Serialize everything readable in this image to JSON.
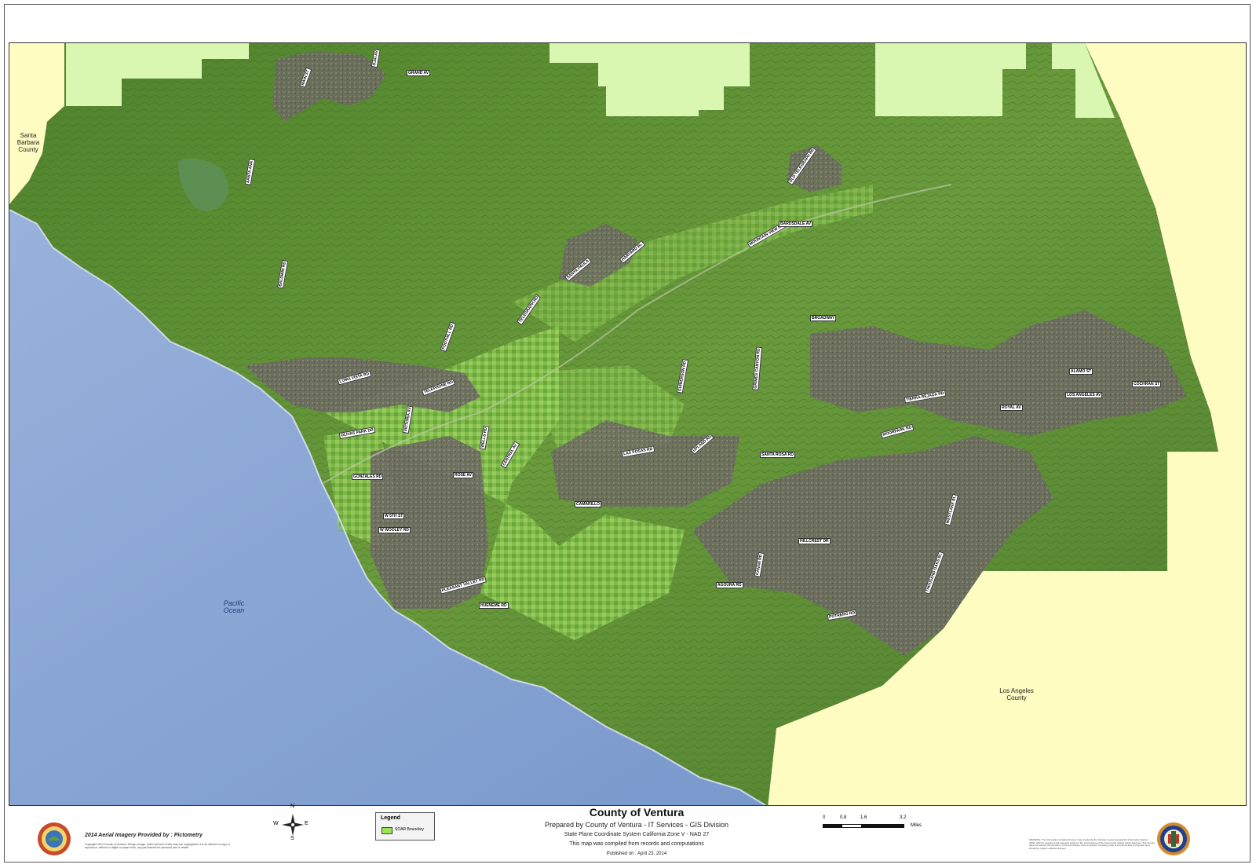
{
  "map": {
    "labels": {
      "santa_barbara": "Santa\nBarbara\nCounty",
      "los_angeles": "Los Angeles\nCounty",
      "ocean": "Pacific\nOcean"
    },
    "roads": [
      "GRAND AV",
      "MAIN ST",
      "SANTA ANA",
      "OJAI AV",
      "BALDWIN RD",
      "TELEGRAPH RD",
      "FOOTHILL RD",
      "LOMA VISTA RD",
      "TELEPHONE RD",
      "VICTORIA AV",
      "OLIVAS PARK DR",
      "GONZALES RD",
      "W 5TH ST",
      "W WOOLEY RD",
      "PLEASANT VALLEY RD",
      "HUENEME RD",
      "LAS POSAS RD",
      "SANTA ROSA RD",
      "TIERRA REJADA RD",
      "MOORPARK RD",
      "LOS ANGELES AV",
      "COCHRAN ST",
      "ALAMO ST",
      "ROYAL AV",
      "BROADWAY",
      "GRIMES CANYON RD",
      "POTRERO RD",
      "HILLCREST DR",
      "THOUSAND OAKS BL",
      "AGOURA RD",
      "KANAN RD",
      "WESTLAKE BL",
      "CAMARILLO",
      "UPLAND RD",
      "CENTRAL AV",
      "ROSE AV",
      "WELLS RD",
      "SANTA PAULA",
      "HARVARD BL",
      "MOUNTAIN VIEW RD",
      "GUIBERSON RD",
      "BARDSDALE AV",
      "OLD TELEGRAPH RD"
    ],
    "colors": {
      "ocean": "#7f9fd0",
      "land": "#5a8a32",
      "neighbor_county": "#fffcc2",
      "forest": "#d9f7b0",
      "soar": "#9be650",
      "urban": "#6a6760"
    }
  },
  "footer": {
    "title": "County of Ventura",
    "prepared_by": "Prepared by County of Ventura - IT Services - GIS Division",
    "projection": "State Plane Coordinate System California Zone V - NAD 27",
    "compiled": "This map was compiled from records and computations",
    "published": "Published on : April 23, 2014",
    "imagery_credit": "2014 Aerial Imagery Provided by : Pictometry",
    "copyright": "Copyright 2014 County of Ventura. Design, image, index and text of this map are copyrighted. It is an offense to copy or reproduce, without or digital or paper form, any part thereof for personal use or resale.",
    "legend_title": "Legend",
    "legend_item": "SOAR Boundary",
    "scale_values": [
      "0",
      "0.8",
      "1.6",
      "3.2"
    ],
    "scale_unit": "Miles",
    "compass": {
      "n": "N",
      "s": "S",
      "e": "E",
      "w": "W"
    },
    "warning": "WARNING: The information contained hereon was created by the Ventura County Geographic Information System (GIS), which is designed and operated solely for the convenience of the County and related public agencies. The County does not warrant the accuracy of this information, and no decision involving a risk of economic loss or physical injury should be made in reliance thereon."
  }
}
